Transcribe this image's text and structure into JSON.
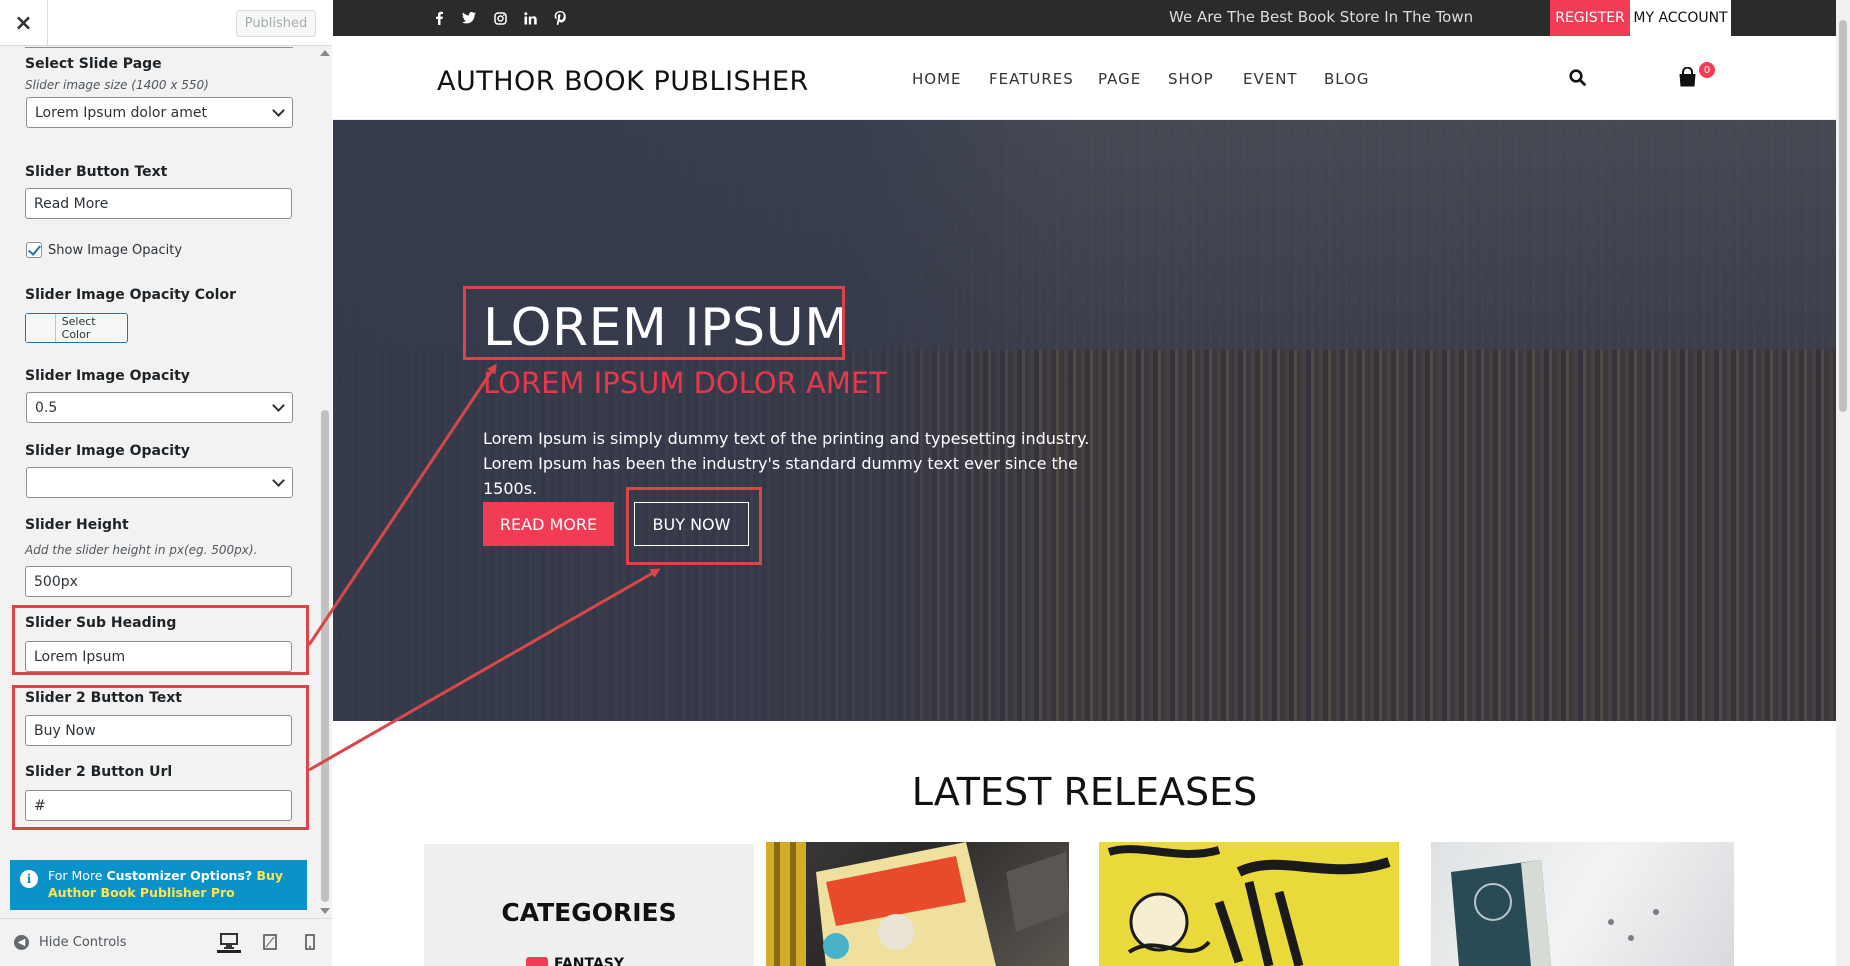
{
  "customizer": {
    "close_label": "×",
    "published_label": "Published",
    "select_slide_page": {
      "title": "Select Slide Page",
      "description": "Slider image size (1400 x 550)",
      "value": "Lorem Ipsum dolor amet"
    },
    "slider_button_text": {
      "title": "Slider Button Text",
      "value": "Read More"
    },
    "show_image_opacity": {
      "label": "Show Image Opacity",
      "checked": true
    },
    "opacity_color": {
      "title": "Slider Image Opacity Color",
      "button_label": "Select Color"
    },
    "image_opacity": {
      "title": "Slider Image Opacity",
      "value": "0.5"
    },
    "image_opacity_2": {
      "title": "Slider Image Opacity",
      "value": ""
    },
    "slider_height": {
      "title": "Slider Height",
      "description": "Add the slider height in px(eg. 500px).",
      "value": "500px"
    },
    "slider_sub_heading": {
      "title": "Slider Sub Heading",
      "value": "Lorem Ipsum"
    },
    "slider2_button_text": {
      "title": "Slider 2 Button Text",
      "value": "Buy Now"
    },
    "slider2_button_url": {
      "title": "Slider 2 Button Url",
      "value": "#"
    },
    "info": {
      "prefix": "For More ",
      "bold": "Customizer Options?",
      "link": " Buy Author Book Publisher Pro"
    },
    "footer": {
      "hide_controls": "Hide Controls"
    }
  },
  "preview": {
    "topbar": {
      "socials": [
        "facebook-icon",
        "twitter-icon",
        "instagram-icon",
        "linkedin-icon",
        "pinterest-icon"
      ],
      "tagline": "We Are The Best Book Store In The Town",
      "register": "REGISTER",
      "account": "MY ACCOUNT"
    },
    "header": {
      "logo": "AUTHOR BOOK PUBLISHER",
      "nav": [
        "HOME",
        "FEATURES",
        "PAGE",
        "SHOP",
        "EVENT",
        "BLOG"
      ],
      "cart_count": "0"
    },
    "hero": {
      "title": "LOREM IPSUM",
      "subtitle": "LOREM IPSUM DOLOR AMET",
      "text": "Lorem Ipsum is simply dummy text of the printing and typesetting industry. Lorem Ipsum has been the industry's standard dummy text ever since the 1500s.",
      "read_more": "READ MORE",
      "buy_now": "BUY NOW"
    },
    "latest": {
      "title": "LATEST RELEASES",
      "categories_title": "CATEGORIES",
      "first_category": "FANTASY"
    }
  },
  "colors": {
    "accent": "#f23c55",
    "annotation_red": "#d9464a",
    "info_blue": "#0b92c8",
    "topbar_dark": "#2b2b2b",
    "hero_overlay": "#31374a"
  }
}
